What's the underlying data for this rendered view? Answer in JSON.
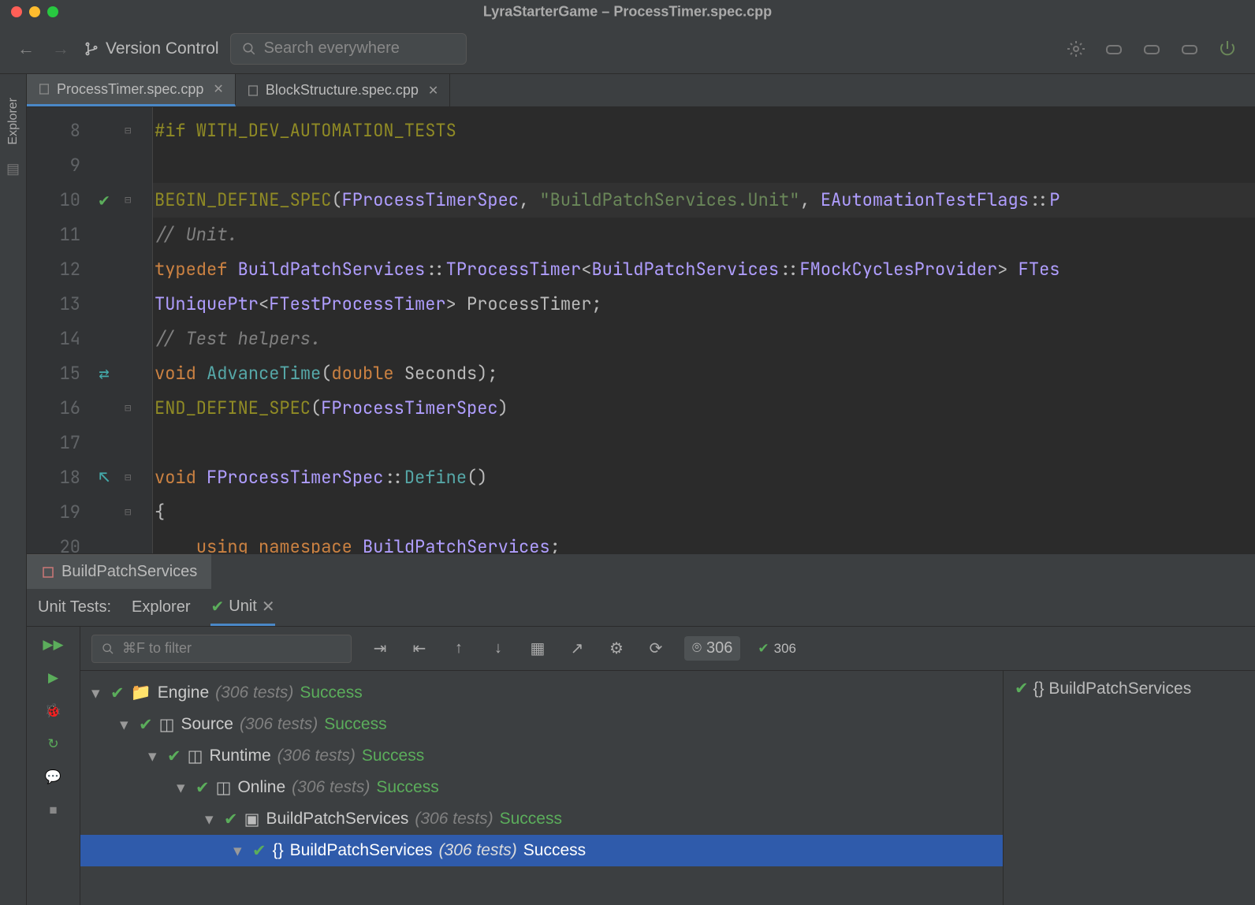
{
  "window": {
    "title": "LyraStarterGame – ProcessTimer.spec.cpp"
  },
  "toolbar": {
    "version_control": "Version Control",
    "search_placeholder": "Search everywhere"
  },
  "sidebar": {
    "explorer": "Explorer"
  },
  "tabs": [
    {
      "label": "ProcessTimer.spec.cpp",
      "active": true
    },
    {
      "label": "BlockStructure.spec.cpp",
      "active": false
    }
  ],
  "editor": {
    "first_line": 8,
    "lines": [
      {
        "n": 8,
        "tokens": [
          [
            "macro",
            "#if WITH_DEV_AUTOMATION_TESTS"
          ]
        ]
      },
      {
        "n": 9,
        "tokens": []
      },
      {
        "n": 10,
        "hl": true,
        "mark": "check",
        "tokens": [
          [
            "macro",
            "BEGIN_DEFINE_SPEC"
          ],
          [
            "punc",
            "("
          ],
          [
            "type",
            "FProcessTimerSpec"
          ],
          [
            "punc",
            ", "
          ],
          [
            "str",
            "\"BuildPatchServices.Unit\""
          ],
          [
            "punc",
            ", "
          ],
          [
            "type",
            "EAutomationTestFlags"
          ],
          [
            "punc",
            "::"
          ],
          [
            "type",
            "P"
          ]
        ]
      },
      {
        "n": 11,
        "tokens": [
          [
            "cmt",
            "// Unit."
          ]
        ]
      },
      {
        "n": 12,
        "tokens": [
          [
            "kw",
            "typedef "
          ],
          [
            "ns",
            "BuildPatchServices"
          ],
          [
            "punc",
            "::"
          ],
          [
            "type",
            "TProcessTimer"
          ],
          [
            "punc",
            "<"
          ],
          [
            "ns",
            "BuildPatchServices"
          ],
          [
            "punc",
            "::"
          ],
          [
            "type",
            "FMockCyclesProvider"
          ],
          [
            "punc",
            "> "
          ],
          [
            "type",
            "FTes"
          ]
        ]
      },
      {
        "n": 13,
        "tokens": [
          [
            "type",
            "TUniquePtr"
          ],
          [
            "punc",
            "<"
          ],
          [
            "type",
            "FTestProcessTimer"
          ],
          [
            "punc",
            "> "
          ],
          [
            "punc",
            "ProcessTimer;"
          ]
        ]
      },
      {
        "n": 14,
        "tokens": [
          [
            "cmt",
            "// Test helpers."
          ]
        ]
      },
      {
        "n": 15,
        "mark": "swap",
        "tokens": [
          [
            "kw",
            "void "
          ],
          [
            "fn",
            "AdvanceTime"
          ],
          [
            "punc",
            "("
          ],
          [
            "kw",
            "double "
          ],
          [
            "punc",
            "Seconds);"
          ]
        ]
      },
      {
        "n": 16,
        "tokens": [
          [
            "macro",
            "END_DEFINE_SPEC"
          ],
          [
            "punc",
            "("
          ],
          [
            "type",
            "FProcessTimerSpec"
          ],
          [
            "punc",
            ")"
          ]
        ]
      },
      {
        "n": 17,
        "tokens": []
      },
      {
        "n": 18,
        "mark": "up",
        "tokens": [
          [
            "kw",
            "void "
          ],
          [
            "type",
            "FProcessTimerSpec"
          ],
          [
            "punc",
            "::"
          ],
          [
            "fn",
            "Define"
          ],
          [
            "punc",
            "()"
          ]
        ]
      },
      {
        "n": 19,
        "tokens": [
          [
            "punc",
            "{"
          ]
        ]
      },
      {
        "n": 20,
        "tokens": [
          [
            "punc",
            "    "
          ],
          [
            "kw",
            "using namespace "
          ],
          [
            "ns",
            "BuildPatchServices"
          ],
          [
            "punc",
            ";"
          ]
        ]
      }
    ]
  },
  "bottom": {
    "panel_title": "BuildPatchServices",
    "subtabs_label": "Unit Tests:",
    "subtabs": [
      {
        "label": "Explorer",
        "active": false
      },
      {
        "label": "Unit",
        "active": true,
        "icon": "check"
      }
    ],
    "filter_placeholder": "⌘F to filter",
    "counts": {
      "total": "306",
      "passed": "306"
    },
    "side_label": "BuildPatchServices",
    "tree": [
      {
        "depth": 0,
        "icon": "folder",
        "name": "Engine",
        "count": "(306 tests)",
        "status": "Success"
      },
      {
        "depth": 1,
        "icon": "module",
        "name": "Source",
        "count": "(306 tests)",
        "status": "Success"
      },
      {
        "depth": 2,
        "icon": "module",
        "name": "Runtime",
        "count": "(306 tests)",
        "status": "Success"
      },
      {
        "depth": 3,
        "icon": "module",
        "name": "Online",
        "count": "(306 tests)",
        "status": "Success"
      },
      {
        "depth": 4,
        "icon": "package",
        "name": "BuildPatchServices",
        "count": "(306 tests)",
        "status": "Success"
      },
      {
        "depth": 5,
        "icon": "ns",
        "name": "BuildPatchServices",
        "count": "(306 tests)",
        "status": "Success",
        "selected": true
      }
    ]
  }
}
